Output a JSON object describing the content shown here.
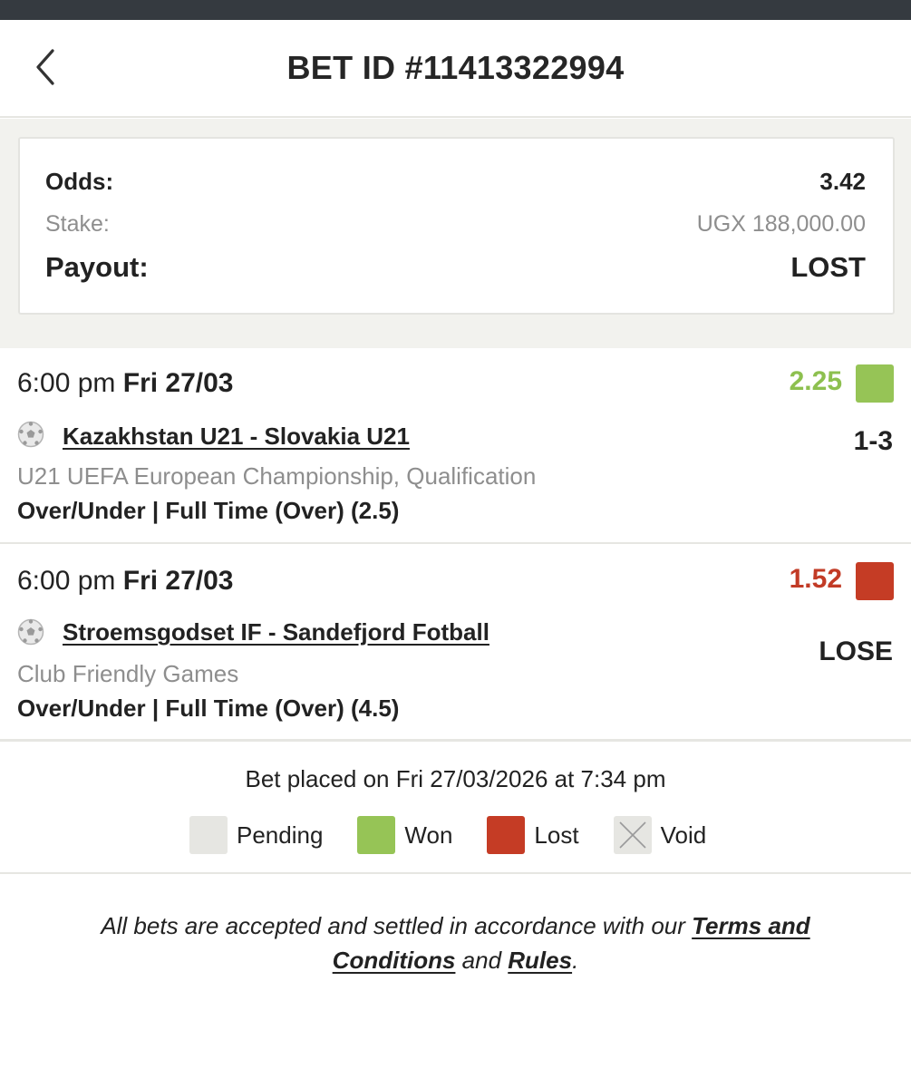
{
  "header": {
    "title": "BET ID #11413322994",
    "back_icon": "chevron-left-icon"
  },
  "summary": {
    "odds_label": "Odds:",
    "odds_value": "3.42",
    "stake_label": "Stake:",
    "stake_value": "UGX 188,000.00",
    "payout_label": "Payout:",
    "payout_value": "LOST"
  },
  "bets": [
    {
      "time": "6:00 pm",
      "date": "Fri 27/03",
      "odds": "2.25",
      "status": "won",
      "status_color": "#96c456",
      "icon": "soccer-ball-icon",
      "match": "Kazakhstan U21 - Slovakia U21",
      "result": "1-3",
      "league": "U21 UEFA European Championship, Qualification",
      "market": "Over/Under | Full Time (Over) (2.5)"
    },
    {
      "time": "6:00 pm",
      "date": "Fri 27/03",
      "odds": "1.52",
      "status": "lost",
      "status_color": "#c53c25",
      "icon": "soccer-ball-icon",
      "match": "Stroemsgodset IF - Sandefjord Fotball",
      "result": "LOSE",
      "league": "Club Friendly Games",
      "market": "Over/Under | Full Time (Over) (4.5)"
    }
  ],
  "placed_text": "Bet placed on Fri 27/03/2026 at 7:34 pm",
  "legend": [
    {
      "label": "Pending",
      "color": "#e6e6e2"
    },
    {
      "label": "Won",
      "color": "#96c456"
    },
    {
      "label": "Lost",
      "color": "#c53c25"
    },
    {
      "label": "Void",
      "color": "#e6e6e2"
    }
  ],
  "footer": {
    "text_before": "All bets are accepted and settled in accordance with our ",
    "terms_link": "Terms and Conditions",
    "text_middle": " and ",
    "rules_link": "Rules",
    "text_after": "."
  }
}
